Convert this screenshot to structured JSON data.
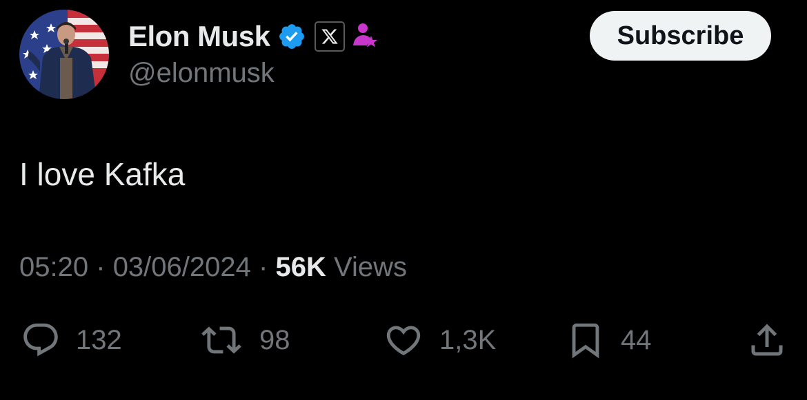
{
  "author": {
    "display_name": "Elon Musk",
    "handle": "@elonmusk",
    "verified_icon": "verified-badge-icon",
    "affiliation_icon": "x-logo-icon",
    "subscriber_icon": "subscriber-star-icon"
  },
  "subscribe_label": "Subscribe",
  "tweet": {
    "text": "I love Kafka",
    "time": "05:20",
    "date": "03/06/2024",
    "separator": "·",
    "views_count": "56K",
    "views_label": "Views"
  },
  "actions": {
    "replies": "132",
    "reposts": "98",
    "likes": "1,3K",
    "bookmarks": "44"
  },
  "colors": {
    "background": "#000000",
    "primary_text": "#e7e9ea",
    "secondary_text": "#71767b",
    "verified_blue": "#1d9bf0",
    "subscriber_purple": "#c936cc",
    "button_bg": "#eff3f4"
  }
}
